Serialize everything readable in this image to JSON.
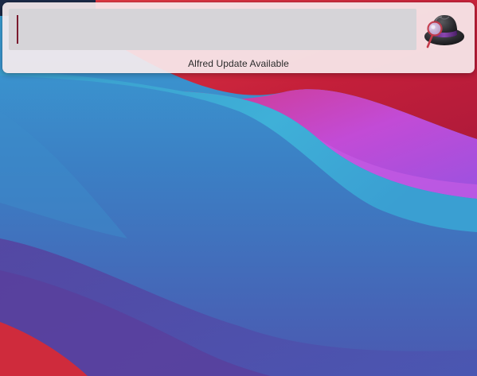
{
  "search": {
    "value": "",
    "placeholder": ""
  },
  "logo": {
    "icon": "alfred-hat-icon"
  },
  "status": {
    "message": "Alfred Update Available"
  },
  "colors": {
    "window_bg": "#f7ecee",
    "field_bg": "#d6d4d8",
    "caret": "#7a1a2e",
    "wallpaper_blue": "#2f8fc8",
    "wallpaper_red": "#c8213a",
    "wallpaper_magenta": "#b44ad8",
    "wallpaper_purple": "#5a3fa0"
  }
}
